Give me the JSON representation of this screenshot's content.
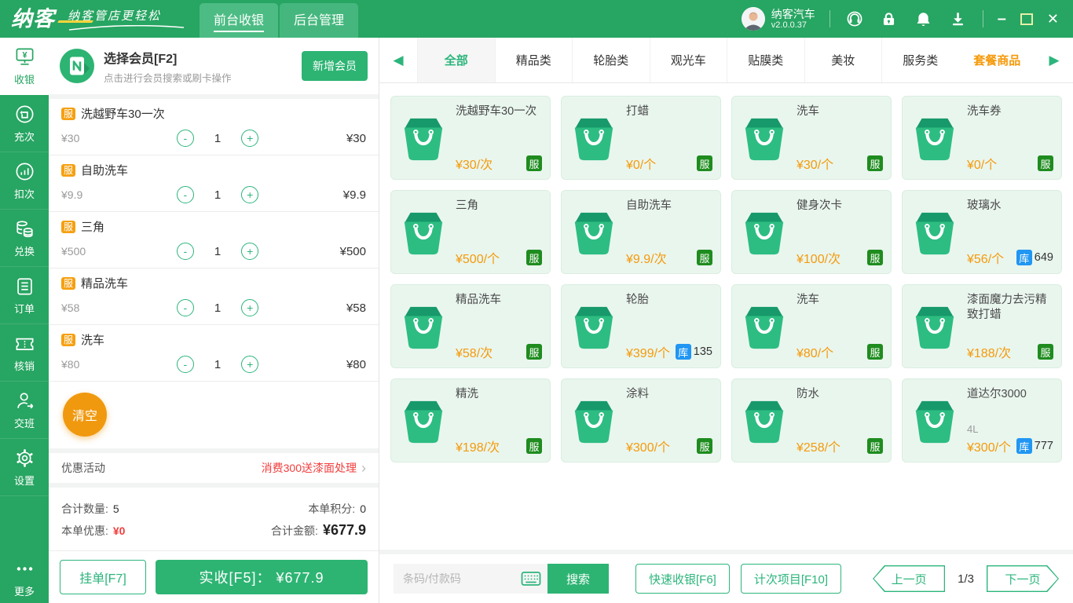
{
  "header": {
    "logo": "纳客",
    "slogan": "纳客管店更轻松",
    "nav": [
      {
        "label": "前台收银"
      },
      {
        "label": "后台管理"
      }
    ],
    "store_name": "纳客汽车",
    "version": "v2.0.0.37",
    "glyphs": {
      "minimize": "–",
      "close": "✕"
    }
  },
  "sidebar": {
    "items": [
      {
        "label": "收银"
      },
      {
        "label": "充次"
      },
      {
        "label": "扣次"
      },
      {
        "label": "兑换"
      },
      {
        "label": "订单"
      },
      {
        "label": "核销"
      },
      {
        "label": "交班"
      },
      {
        "label": "设置"
      },
      {
        "label": "更多"
      }
    ]
  },
  "member": {
    "title": "选择会员[F2]",
    "subtitle": "点击进行会员搜索或刷卡操作",
    "add_button": "新增会员"
  },
  "cart": {
    "minus": "-",
    "plus": "+",
    "items": [
      {
        "badge": "服",
        "name": "洗越野车30一次",
        "unit_price": "¥30",
        "qty": "1",
        "total": "¥30"
      },
      {
        "badge": "服",
        "name": "自助洗车",
        "unit_price": "¥9.9",
        "qty": "1",
        "total": "¥9.9"
      },
      {
        "badge": "服",
        "name": "三角",
        "unit_price": "¥500",
        "qty": "1",
        "total": "¥500"
      },
      {
        "badge": "服",
        "name": "精品洗车",
        "unit_price": "¥58",
        "qty": "1",
        "total": "¥58"
      },
      {
        "badge": "服",
        "name": "洗车",
        "unit_price": "¥80",
        "qty": "1",
        "total": "¥80"
      }
    ],
    "clear_button": "清空",
    "promo_label": "优惠活动",
    "promo_value": "消费300送漆面处理",
    "promo_chevron": "›",
    "totals": {
      "qty_label": "合计数量:",
      "qty": "5",
      "points_label": "本单积分:",
      "points": "0",
      "discount_label": "本单优惠:",
      "discount": "¥0",
      "amount_label": "合计金额:",
      "amount": "¥677.9"
    },
    "hold_button": "挂单[F7]",
    "checkout_button": "实收[F5]：  ¥677.9"
  },
  "categories": {
    "prev_arrow": "◀",
    "next_arrow": "▶",
    "tabs": [
      {
        "label": "全部"
      },
      {
        "label": "精品类"
      },
      {
        "label": "轮胎类"
      },
      {
        "label": "观光车"
      },
      {
        "label": "贴膜类"
      },
      {
        "label": "美妆"
      },
      {
        "label": "服务类"
      },
      {
        "label": "套餐商品"
      }
    ]
  },
  "products": [
    {
      "name": "洗越野车30一次",
      "price": "¥30/次",
      "tag": "服"
    },
    {
      "name": "打蜡",
      "price": "¥0/个",
      "tag": "服"
    },
    {
      "name": "洗车",
      "price": "¥30/个",
      "tag": "服"
    },
    {
      "name": "洗车券",
      "price": "¥0/个",
      "tag": "服"
    },
    {
      "name": "三角",
      "price": "¥500/个",
      "tag": "服"
    },
    {
      "name": "自助洗车",
      "price": "¥9.9/次",
      "tag": "服"
    },
    {
      "name": "健身次卡",
      "price": "¥100/次",
      "tag": "服"
    },
    {
      "name": "玻璃水",
      "price": "¥56/个",
      "tag": "库",
      "stock": "649"
    },
    {
      "name": "精品洗车",
      "price": "¥58/次",
      "tag": "服"
    },
    {
      "name": "轮胎",
      "price": "¥399/个",
      "tag": "库",
      "stock": "135"
    },
    {
      "name": "洗车",
      "price": "¥80/个",
      "tag": "服"
    },
    {
      "name": "漆面魔力去污精致打蜡",
      "price": "¥188/次",
      "tag": "服"
    },
    {
      "name": "精洗",
      "price": "¥198/次",
      "tag": "服"
    },
    {
      "name": "涂料",
      "price": "¥300/个",
      "tag": "服"
    },
    {
      "name": "防水",
      "price": "¥258/个",
      "tag": "服"
    },
    {
      "name": "道达尔3000",
      "subtitle": "4L",
      "price": "¥300/个",
      "tag": "库",
      "stock": "777"
    }
  ],
  "bottom_bar": {
    "search_placeholder": "条码/付款码",
    "search_button": "搜索",
    "quick_button": "快速收银[F6]",
    "count_button": "计次项目[F10]",
    "prev_page": "上一页",
    "page": "1/3",
    "next_page": "下一页"
  }
}
